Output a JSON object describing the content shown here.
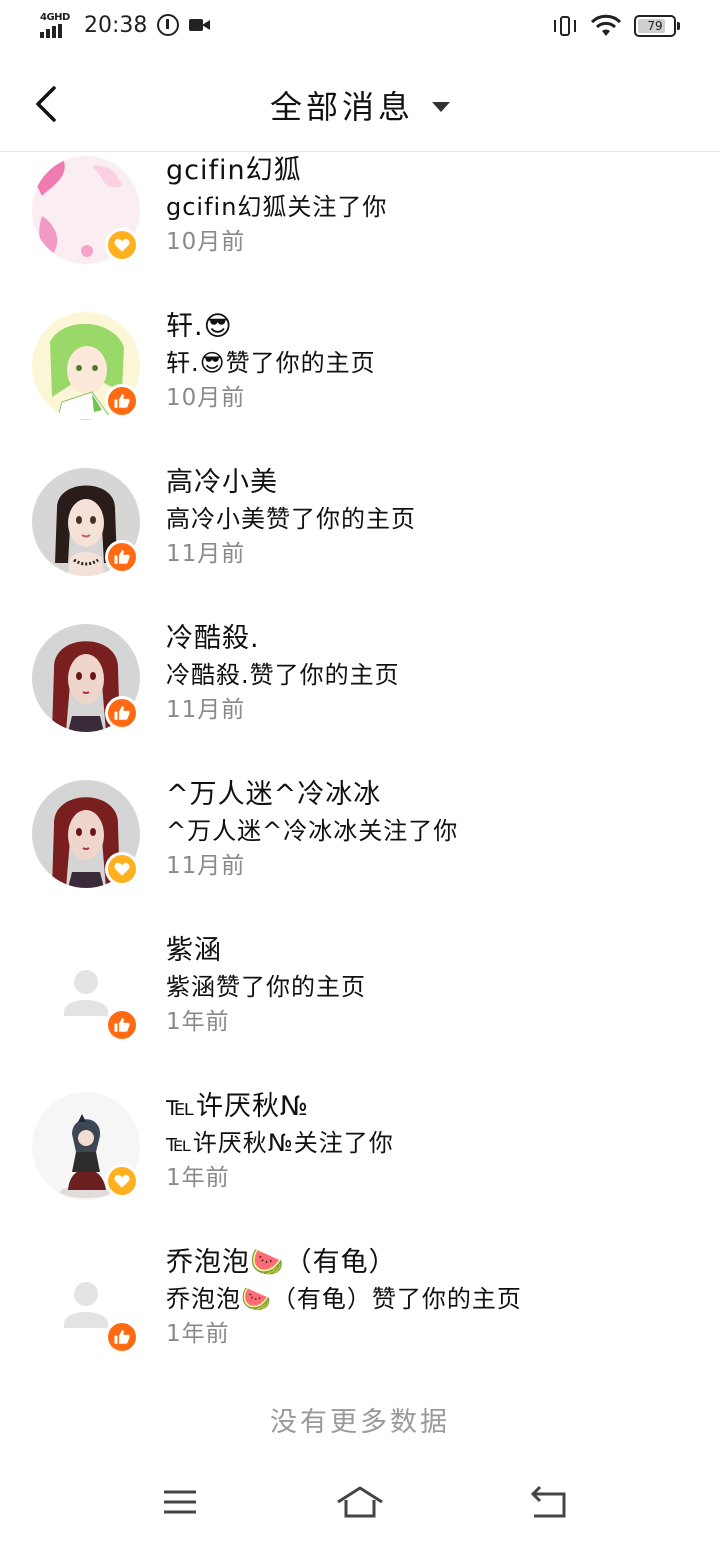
{
  "status_bar": {
    "network": "4GHD",
    "time": "20:38",
    "battery": "79",
    "battery_level": 0.79
  },
  "header": {
    "title": "全部消息"
  },
  "messages": [
    {
      "name": "gcifin幻狐",
      "action": "gcifin幻狐关注了你",
      "time": "10月前",
      "type": "follow",
      "avatar": "pink-art"
    },
    {
      "name": "轩.😎",
      "action": "轩.😎赞了你的主页",
      "time": "10月前",
      "type": "like",
      "avatar": "green-hair-anime"
    },
    {
      "name": "高冷小美",
      "action": "高冷小美赞了你的主页",
      "time": "11月前",
      "type": "like",
      "avatar": "black-hair-doll"
    },
    {
      "name": "冷酷殺.",
      "action": "冷酷殺.赞了你的主页",
      "time": "11月前",
      "type": "like",
      "avatar": "red-hair-doll"
    },
    {
      "name": "^万人迷^冷冰冰",
      "action": "^万人迷^冷冰冰关注了你",
      "time": "11月前",
      "type": "follow",
      "avatar": "red-hair-doll"
    },
    {
      "name": "紫涵",
      "action": "紫涵赞了你的主页",
      "time": "1年前",
      "type": "like",
      "avatar": "default-user"
    },
    {
      "name": "℡许厌秋№",
      "action": "℡许厌秋№关注了你",
      "time": "1年前",
      "type": "follow",
      "avatar": "anime-girl-dress"
    },
    {
      "name": "乔泡泡🍉（有龟）",
      "action": "乔泡泡🍉（有龟）赞了你的主页",
      "time": "1年前",
      "type": "like",
      "avatar": "default-user"
    }
  ],
  "footer": {
    "no_more": "没有更多数据"
  },
  "colors": {
    "follow_badge": "#ffb01f",
    "like_badge": "#ff6a13"
  }
}
